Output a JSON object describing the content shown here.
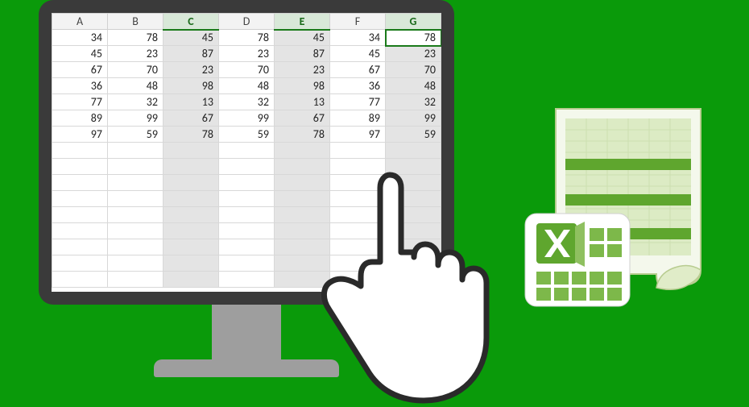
{
  "spreadsheet": {
    "columns": [
      "A",
      "B",
      "C",
      "D",
      "E",
      "F",
      "G"
    ],
    "selected_columns": [
      "C",
      "E",
      "G"
    ],
    "active_cell": {
      "col": "G",
      "row": 0
    },
    "rows": [
      [
        34,
        78,
        45,
        78,
        45,
        34,
        78
      ],
      [
        45,
        23,
        87,
        23,
        87,
        45,
        23
      ],
      [
        67,
        70,
        23,
        70,
        23,
        67,
        70
      ],
      [
        36,
        48,
        98,
        48,
        98,
        36,
        48
      ],
      [
        77,
        32,
        13,
        32,
        13,
        77,
        32
      ],
      [
        89,
        99,
        67,
        99,
        67,
        89,
        99
      ],
      [
        97,
        59,
        78,
        59,
        78,
        97,
        59
      ]
    ],
    "blank_rows": 9
  },
  "chart_data": {
    "type": "table",
    "title": "",
    "columns": [
      "A",
      "B",
      "C",
      "D",
      "E",
      "F",
      "G"
    ],
    "series": [
      {
        "name": "A",
        "values": [
          34,
          45,
          67,
          36,
          77,
          89,
          97
        ]
      },
      {
        "name": "B",
        "values": [
          78,
          23,
          70,
          48,
          32,
          99,
          59
        ]
      },
      {
        "name": "C",
        "values": [
          45,
          87,
          23,
          98,
          13,
          67,
          78
        ]
      },
      {
        "name": "D",
        "values": [
          78,
          23,
          70,
          48,
          32,
          99,
          59
        ]
      },
      {
        "name": "E",
        "values": [
          45,
          87,
          23,
          98,
          13,
          67,
          78
        ]
      },
      {
        "name": "F",
        "values": [
          34,
          45,
          67,
          36,
          77,
          89,
          97
        ]
      },
      {
        "name": "G",
        "values": [
          78,
          23,
          70,
          48,
          32,
          99,
          59
        ]
      }
    ]
  },
  "icons": {
    "hand": "pointing-hand-icon",
    "excel": "excel-document-icon"
  }
}
